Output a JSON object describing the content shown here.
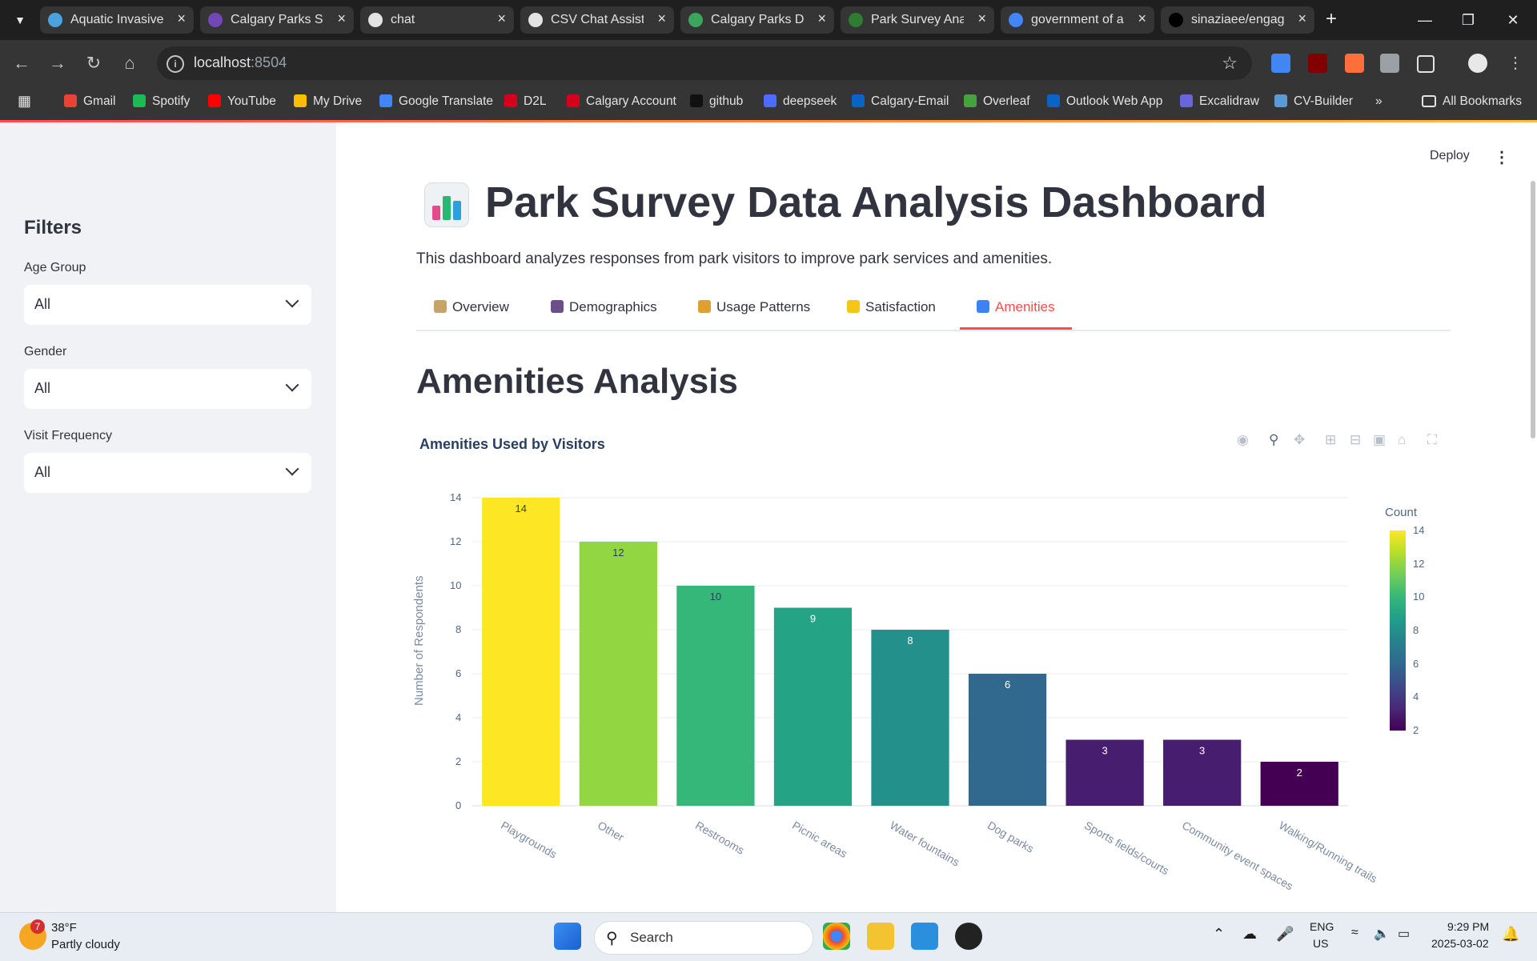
{
  "browser": {
    "tabs": [
      {
        "title": "Aquatic Invasive",
        "icon": "globe-icon",
        "color": "#4aa3df"
      },
      {
        "title": "Calgary Parks Su",
        "icon": "forms-icon",
        "color": "#7248b9"
      },
      {
        "title": "chat",
        "icon": "crown-icon",
        "color": "#e3e3e3"
      },
      {
        "title": "CSV Chat Assista",
        "icon": "crown-icon",
        "color": "#e3e3e3"
      },
      {
        "title": "Calgary Parks Da",
        "icon": "tree-icon",
        "color": "#3ba55c"
      },
      {
        "title": "Park Survey Anal",
        "icon": "streamlit-icon",
        "color": "#2e7d32"
      },
      {
        "title": "government of a",
        "icon": "google-icon",
        "color": "#4285f4"
      },
      {
        "title": "sinaziaee/engag",
        "icon": "github-icon",
        "color": "#000000"
      }
    ],
    "url_host": "localhost",
    "url_port": ":8504",
    "bookmarks": [
      {
        "label": "Gmail",
        "icon": "gmail-icon",
        "color": "#ea4335"
      },
      {
        "label": "Spotify",
        "icon": "spotify-icon",
        "color": "#1db954"
      },
      {
        "label": "YouTube",
        "icon": "youtube-icon",
        "color": "#ff0000"
      },
      {
        "label": "My Drive",
        "icon": "drive-icon",
        "color": "#fbbc04"
      },
      {
        "label": "Google Translate",
        "icon": "translate-icon",
        "color": "#4285f4"
      },
      {
        "label": "D2L",
        "icon": "ucalgary-icon",
        "color": "#d6001c"
      },
      {
        "label": "Calgary Account",
        "icon": "ucalgary-icon",
        "color": "#d6001c"
      },
      {
        "label": "github",
        "icon": "github-icon",
        "color": "#111111"
      },
      {
        "label": "deepseek",
        "icon": "deepseek-icon",
        "color": "#4d6bfe"
      },
      {
        "label": "Calgary-Email",
        "icon": "outlook-icon",
        "color": "#0a64c8"
      },
      {
        "label": "Overleaf",
        "icon": "overleaf-icon",
        "color": "#47a141"
      },
      {
        "label": "Outlook Web App",
        "icon": "outlook-icon",
        "color": "#0a64c8"
      },
      {
        "label": "Excalidraw",
        "icon": "excalidraw-icon",
        "color": "#6965db"
      },
      {
        "label": "CV-Builder",
        "icon": "cvbuilder-icon",
        "color": "#5b9bd5"
      }
    ],
    "all_bookmarks": "All Bookmarks"
  },
  "app": {
    "deploy_label": "Deploy",
    "sidebar": {
      "title": "Filters",
      "filters": [
        {
          "label": "Age Group",
          "value": "All"
        },
        {
          "label": "Gender",
          "value": "All"
        },
        {
          "label": "Visit Frequency",
          "value": "All"
        }
      ]
    },
    "title": "Park Survey Data Analysis Dashboard",
    "subtitle": "This dashboard analyzes responses from park visitors to improve park services and amenities.",
    "tabs": [
      {
        "label": "Overview",
        "icon": "clipboard-icon",
        "color": "#c9a26b"
      },
      {
        "label": "Demographics",
        "icon": "people-icon",
        "color": "#6b4f8a"
      },
      {
        "label": "Usage Patterns",
        "icon": "walking-person-icon",
        "color": "#e0a030"
      },
      {
        "label": "Satisfaction",
        "icon": "star-icon",
        "color": "#f5c518"
      },
      {
        "label": "Amenities",
        "icon": "magnifier-icon",
        "color": "#3b82f6"
      }
    ],
    "active_tab": "Amenities",
    "section_title": "Amenities Analysis"
  },
  "chart_data": {
    "type": "bar",
    "title": "Amenities Used by Visitors",
    "xlabel": "",
    "ylabel": "Number of Respondents",
    "categories": [
      "Playgrounds",
      "Other",
      "Restrooms",
      "Picnic areas",
      "Water fountains",
      "Dog parks",
      "Sports fields/courts",
      "Community event spaces",
      "Walking/Running trails"
    ],
    "values": [
      14,
      12,
      10,
      9,
      8,
      6,
      3,
      3,
      2
    ],
    "ylim": [
      0,
      14
    ],
    "yticks": [
      0,
      2,
      4,
      6,
      8,
      10,
      12,
      14
    ],
    "grid": true,
    "colorscale": "viridis",
    "legend": {
      "title": "Count",
      "ticks": [
        2,
        4,
        6,
        8,
        10,
        12,
        14
      ],
      "range": [
        2,
        14
      ],
      "placement": "right"
    }
  },
  "taskbar": {
    "weather_badge": "7",
    "temperature": "38°F",
    "weather": "Partly cloudy",
    "search_placeholder": "Search",
    "lang_top": "ENG",
    "lang_bottom": "US",
    "time": "9:29 PM",
    "date": "2025-03-02"
  }
}
